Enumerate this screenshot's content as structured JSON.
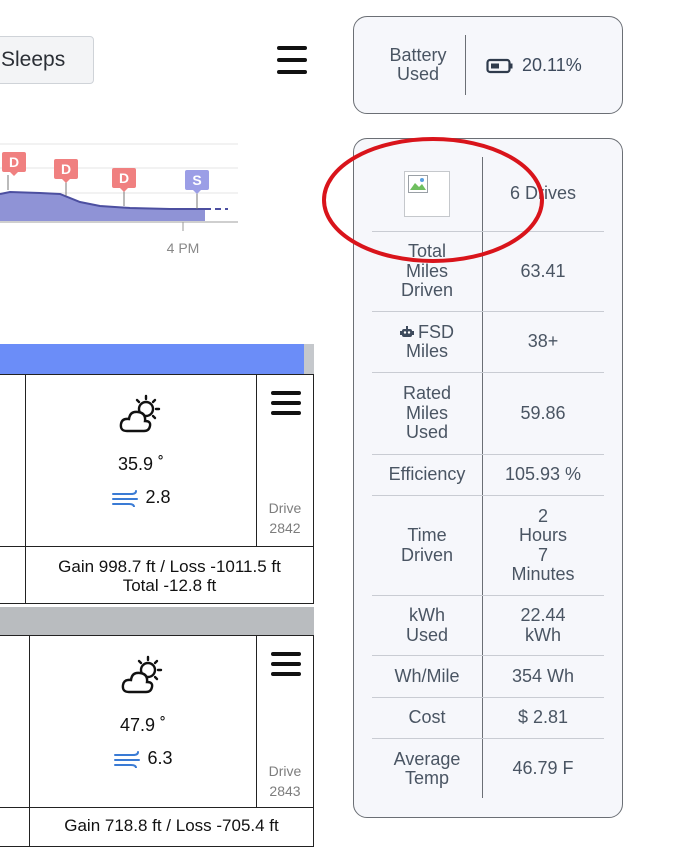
{
  "toolbar": {
    "sleeps_label": "Sleeps"
  },
  "mini_chart": {
    "markers": [
      "D",
      "D",
      "D",
      "S"
    ],
    "x_tick": "4 PM",
    "colors": {
      "drive_marker": "#f08080",
      "sleep_marker": "#9b9ee6",
      "area": "#8a8fd8",
      "line": "#4c4fa0"
    }
  },
  "drives": [
    {
      "temp": "35.9 ˚",
      "wind": "2.8",
      "drive_label": "Drive",
      "drive_number": "2842",
      "elevation_line1": "Gain 998.7 ft / Loss -1011.5 ft",
      "elevation_line2": "Total -12.8 ft",
      "weather_icon": "partly-cloudy-icon"
    },
    {
      "temp": "47.9 ˚",
      "wind": "6.3",
      "drive_label": "Drive",
      "drive_number": "2843",
      "elevation_line1": "Gain 718.8 ft / Loss -705.4 ft",
      "weather_icon": "partly-cloudy-icon"
    }
  ],
  "battery": {
    "label_line1": "Battery",
    "label_line2": "Used",
    "value": "20.11%"
  },
  "stats": {
    "drives": "6 Drives",
    "total_miles": {
      "l1": "Total",
      "l2": "Miles",
      "l3": "Driven",
      "value": "63.41"
    },
    "fsd": {
      "l1": "FSD",
      "l2": "Miles",
      "value": "38+"
    },
    "rated": {
      "l1": "Rated",
      "l2": "Miles",
      "l3": "Used",
      "value": "59.86"
    },
    "efficiency": {
      "label": "Efficiency",
      "value": "105.93 %"
    },
    "time": {
      "l1": "Time",
      "l2": "Driven",
      "v1": "2",
      "v2": "Hours",
      "v3": "7",
      "v4": "Minutes"
    },
    "kwh": {
      "l1": "kWh",
      "l2": "Used",
      "v1": "22.44",
      "v2": "kWh"
    },
    "whmile": {
      "label": "Wh/Mile",
      "value": "354 Wh"
    },
    "cost": {
      "label": "Cost",
      "value": "$ 2.81"
    },
    "avg_temp": {
      "l1": "Average",
      "l2": "Temp",
      "value": "46.79 F"
    }
  },
  "annotation_color": "#d9141b"
}
